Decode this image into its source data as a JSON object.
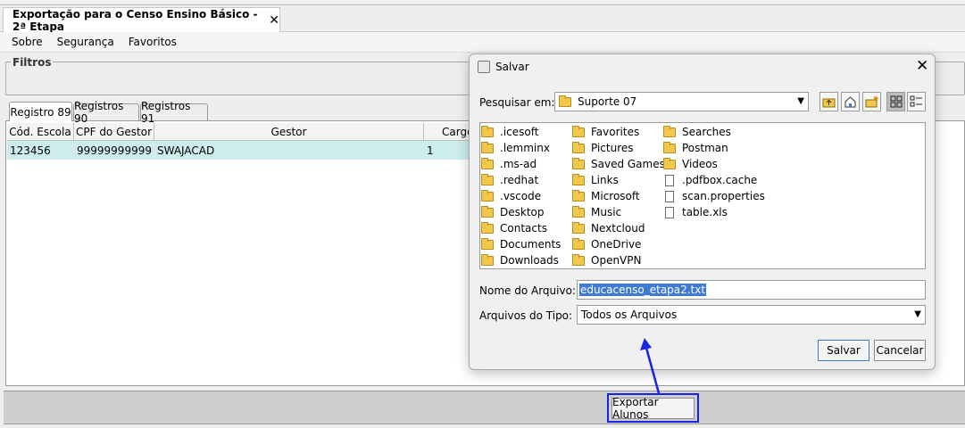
{
  "tab": {
    "title": "Exportação para o Censo Ensino Básico - 2ª Etapa",
    "close": "✕"
  },
  "menu": [
    "Sobre",
    "Segurança",
    "Favoritos"
  ],
  "filters": {
    "label": "Filtros"
  },
  "record_tabs": [
    "Registro 89",
    "Registros 90",
    "Registros 91"
  ],
  "table": {
    "columns": [
      "Cód. Escola",
      "CPF do Gestor",
      "Gestor",
      "Cargo"
    ],
    "rows": [
      [
        "123456",
        "99999999999",
        "SWAJACAD",
        "1"
      ]
    ]
  },
  "export_button": "Exportar Alunos",
  "dialog": {
    "title": "Salvar",
    "close": "✕",
    "look_in_label": "Pesquisar em:",
    "look_in_value": "Suporte 07",
    "folders": [
      ".icesoft",
      ".lemminx",
      ".ms-ad",
      ".redhat",
      ".vscode",
      "Desktop",
      "Contacts",
      "Documents",
      "Downloads",
      "Favorites",
      "Pictures",
      "Saved Games",
      "Links",
      "Microsoft",
      "Music",
      "Nextcloud",
      "OneDrive",
      "OpenVPN",
      "Searches",
      "Postman",
      "Videos"
    ],
    "files": [
      ".pdfbox.cache",
      "scan.properties",
      "table.xls"
    ],
    "filename_label": "Nome do Arquivo:",
    "filename_value": "educacenso_etapa2.txt",
    "filetype_label": "Arquivos do Tipo:",
    "filetype_value": "Todos os Arquivos",
    "save_label": "Salvar",
    "cancel_label": "Cancelar"
  },
  "colors": {
    "highlight": "#1a25e0",
    "selected_row": "#cdeded",
    "selection": "#3f7bd4"
  }
}
